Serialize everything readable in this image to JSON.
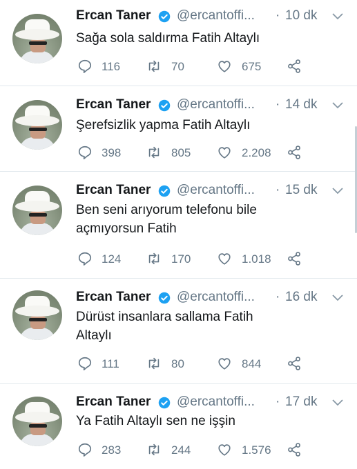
{
  "tweets": [
    {
      "name": "Ercan Taner",
      "handle": "@ercantoffi...",
      "dot": "·",
      "time": "10 dk",
      "text": "Sağa sola saldırma Fatih Altaylı",
      "replies": "116",
      "retweets": "70",
      "likes": "675"
    },
    {
      "name": "Ercan Taner",
      "handle": "@ercantoffi...",
      "dot": "·",
      "time": "14 dk",
      "text": "Şerefsizlik yapma  Fatih Altaylı",
      "replies": "398",
      "retweets": "805",
      "likes": "2.208"
    },
    {
      "name": "Ercan Taner",
      "handle": "@ercantoffi...",
      "dot": "·",
      "time": "15 dk",
      "text": "Ben seni arıyorum telefonu bile açmıyorsun Fatih",
      "replies": "124",
      "retweets": "170",
      "likes": "1.018"
    },
    {
      "name": "Ercan Taner",
      "handle": "@ercantoffi...",
      "dot": "·",
      "time": "16 dk",
      "text": "Dürüst insanlara sallama Fatih Altaylı",
      "replies": "111",
      "retweets": "80",
      "likes": "844"
    },
    {
      "name": "Ercan Taner",
      "handle": "@ercantoffi...",
      "dot": "·",
      "time": "17 dk",
      "text": "Ya Fatih  Altaylı sen ne işşin",
      "replies": "283",
      "retweets": "244",
      "likes": "1.576"
    }
  ],
  "icons": {
    "reply": "reply-icon",
    "retweet": "retweet-icon",
    "like": "heart-icon",
    "share": "share-icon",
    "verified": "verified-badge-icon",
    "caret": "chevron-down-icon"
  },
  "colors": {
    "verified": "#1da1f2",
    "secondary": "#657786",
    "divider": "#e1e8ed"
  }
}
